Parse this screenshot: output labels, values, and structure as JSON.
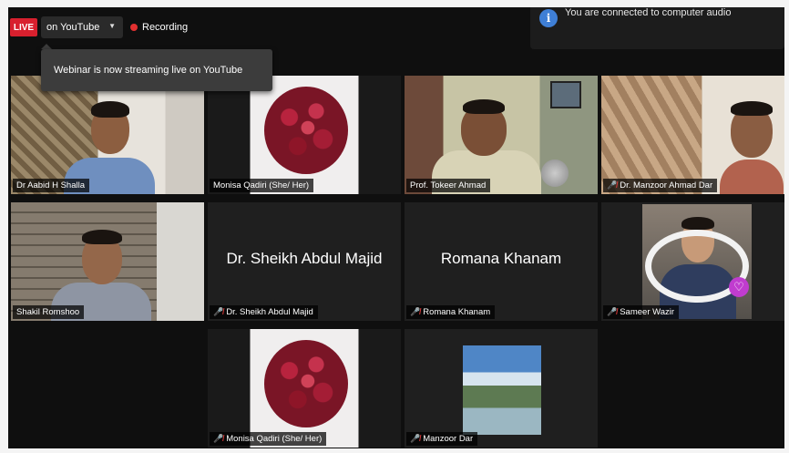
{
  "top_bar": {
    "live_badge": "LIVE",
    "stream_target": "on YouTube",
    "recording_label": "Recording",
    "audio_message": "You are connected to computer audio",
    "stream_toast": "Webinar is now streaming live on YouTube"
  },
  "participants": [
    {
      "name": "Dr Aabid H Shalla",
      "muted": false
    },
    {
      "name": "Monisa Qadiri  (She/ Her)",
      "muted": false
    },
    {
      "name": "Prof. Tokeer Ahmad",
      "muted": false,
      "active_speaker": true
    },
    {
      "name": "Dr. Manzoor Ahmad Dar",
      "muted": true
    },
    {
      "name": "Shakil Romshoo",
      "muted": false
    },
    {
      "name": "Dr. Sheikh Abdul Majid",
      "muted": true,
      "display_text": "Dr. Sheikh Abdul Majid"
    },
    {
      "name": "Romana Khanam",
      "muted": true,
      "display_text": "Romana Khanam"
    },
    {
      "name": "Sameer Wazir",
      "muted": true
    },
    {
      "name": "Monisa Qadiri  (She/ Her)",
      "muted": true
    },
    {
      "name": "Manzoor Dar",
      "muted": true
    }
  ],
  "colors": {
    "live_red": "#d8202e",
    "active_speaker_border": "#c9d64a",
    "muted_mic": "#e23b3b",
    "info_blue": "#3f7fd6"
  },
  "icons": {
    "muted": "mic-muted-icon",
    "info": "info-icon",
    "recording": "recording-dot-icon",
    "dropdown": "chevron-down-icon"
  }
}
